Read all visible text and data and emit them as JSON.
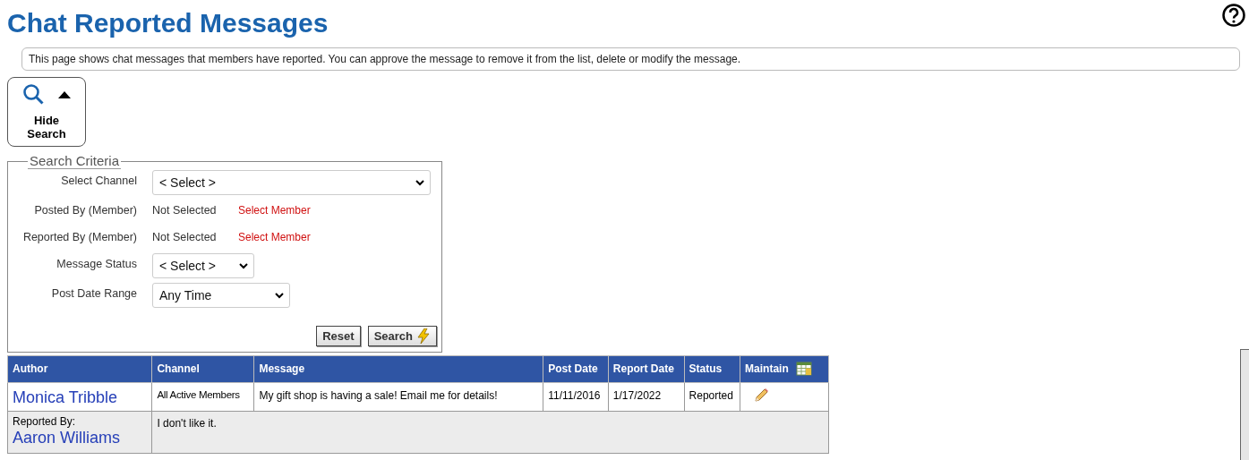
{
  "title": "Chat Reported Messages",
  "info": "This page shows chat messages that members have reported. You can approve the message to remove it from the list, delete or modify the message.",
  "toggle": {
    "label": "Hide Search",
    "expanded": true
  },
  "search": {
    "legend": "Search Criteria",
    "fields": [
      {
        "kind": "select",
        "label": "Select Channel",
        "value": "< Select >"
      },
      {
        "kind": "member",
        "label": "Posted By (Member)",
        "value": "Not Selected",
        "link": "Select Member"
      },
      {
        "kind": "member",
        "label": "Reported By (Member)",
        "value": "Not Selected",
        "link": "Select Member"
      },
      {
        "kind": "select",
        "label": "Message Status",
        "value": "< Select >"
      },
      {
        "kind": "select",
        "label": "Post Date Range",
        "value": "Any Time"
      }
    ],
    "buttons": [
      "Reset",
      "Search"
    ]
  },
  "table": {
    "columns": [
      "Author",
      "Channel",
      "Message",
      "Post Date",
      "Report Date",
      "Status",
      "Maintain"
    ],
    "rows": [
      {
        "author": "Monica Tribble",
        "channel": "All Active Members",
        "message": "My gift shop is having a sale! Email me for details!",
        "post_date": "11/11/2016",
        "report_date": "1/17/2022",
        "status": "Reported",
        "reported_by_label": "Reported By:",
        "reported_by": "Aaron Williams",
        "reason": "I don't like it."
      }
    ]
  }
}
